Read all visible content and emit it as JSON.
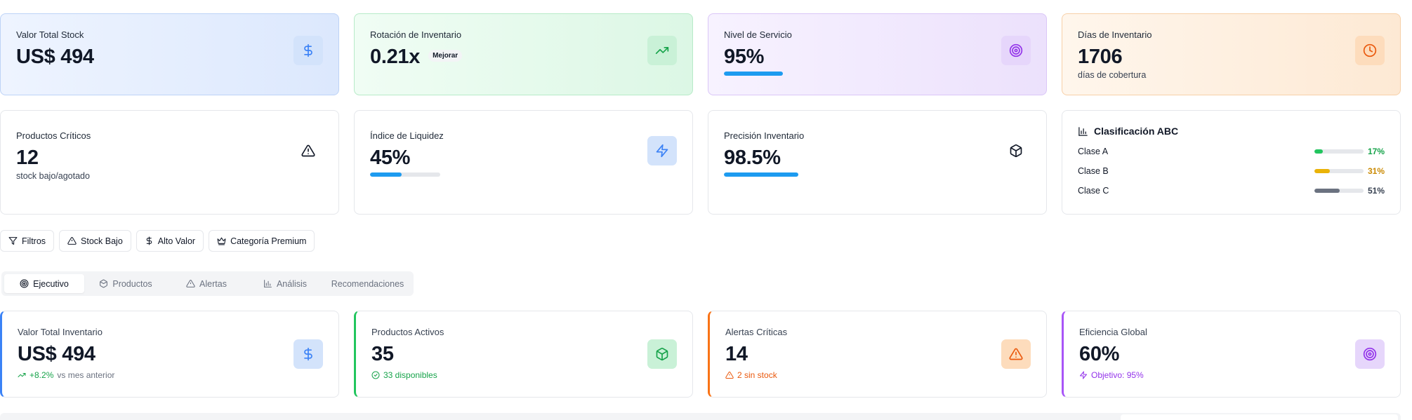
{
  "top_cards": [
    {
      "label": "Valor Total Stock",
      "value": "US$ 494",
      "icon": "dollar-icon"
    },
    {
      "label": "Rotación de Inventario",
      "value": "0.21x",
      "badge": "Mejorar",
      "icon": "trending-up-icon"
    },
    {
      "label": "Nivel de Servicio",
      "value": "95%",
      "progress": 0.95,
      "icon": "target-icon"
    },
    {
      "label": "Días de Inventario",
      "value": "1706",
      "sub": "días de cobertura",
      "icon": "clock-icon"
    }
  ],
  "second_cards": [
    {
      "label": "Productos Críticos",
      "value": "12",
      "sub": "stock bajo/agotado",
      "icon": "warning-icon"
    },
    {
      "label": "Índice de Liquidez",
      "value": "45%",
      "progress": 0.45,
      "icon": "zap-icon"
    },
    {
      "label": "Precisión Inventario",
      "value": "98.5%",
      "progress": 0.985,
      "icon": "box-icon"
    }
  ],
  "abc": {
    "title": "Clasificación ABC",
    "rows": [
      {
        "label": "Clase A",
        "pct": "17%",
        "value": 0.17,
        "color": "#22c55e"
      },
      {
        "label": "Clase B",
        "pct": "31%",
        "value": 0.31,
        "color": "#eab308"
      },
      {
        "label": "Clase C",
        "pct": "51%",
        "value": 0.51,
        "color": "#6b7280"
      }
    ]
  },
  "filters": [
    {
      "label": "Filtros",
      "icon": "filter-icon"
    },
    {
      "label": "Stock Bajo",
      "icon": "warning-icon"
    },
    {
      "label": "Alto Valor",
      "icon": "dollar-icon"
    },
    {
      "label": "Categoría Premium",
      "icon": "crown-icon"
    }
  ],
  "tabs": [
    {
      "label": "Ejecutivo",
      "icon": "target-icon",
      "active": true
    },
    {
      "label": "Productos",
      "icon": "box-icon"
    },
    {
      "label": "Alertas",
      "icon": "warning-icon"
    },
    {
      "label": "Análisis",
      "icon": "bar-chart-icon"
    },
    {
      "label": "Recomendaciones",
      "icon": ""
    }
  ],
  "kpis": [
    {
      "label": "Valor Total Inventario",
      "value": "US$ 494",
      "note_strong": "+8.2%",
      "note_rest": "vs mes anterior",
      "note_color": "#16a34a",
      "icon": "dollar-icon"
    },
    {
      "label": "Productos Activos",
      "value": "35",
      "note_strong": "33 disponibles",
      "note_rest": "",
      "note_color": "#16a34a",
      "icon": "box-icon"
    },
    {
      "label": "Alertas Críticas",
      "value": "14",
      "note_strong": "2 sin stock",
      "note_rest": "",
      "note_color": "#ea580c",
      "icon": "warning-icon"
    },
    {
      "label": "Eficiencia Global",
      "value": "60%",
      "note_strong": "Objetivo: 95%",
      "note_rest": "",
      "note_color": "#9333ea",
      "icon": "zap-icon"
    }
  ],
  "colors": {
    "blue": "#3b82f6",
    "green": "#16a34a",
    "purple": "#9333ea",
    "orange": "#ea580c",
    "progress": "#1d9bf0"
  }
}
